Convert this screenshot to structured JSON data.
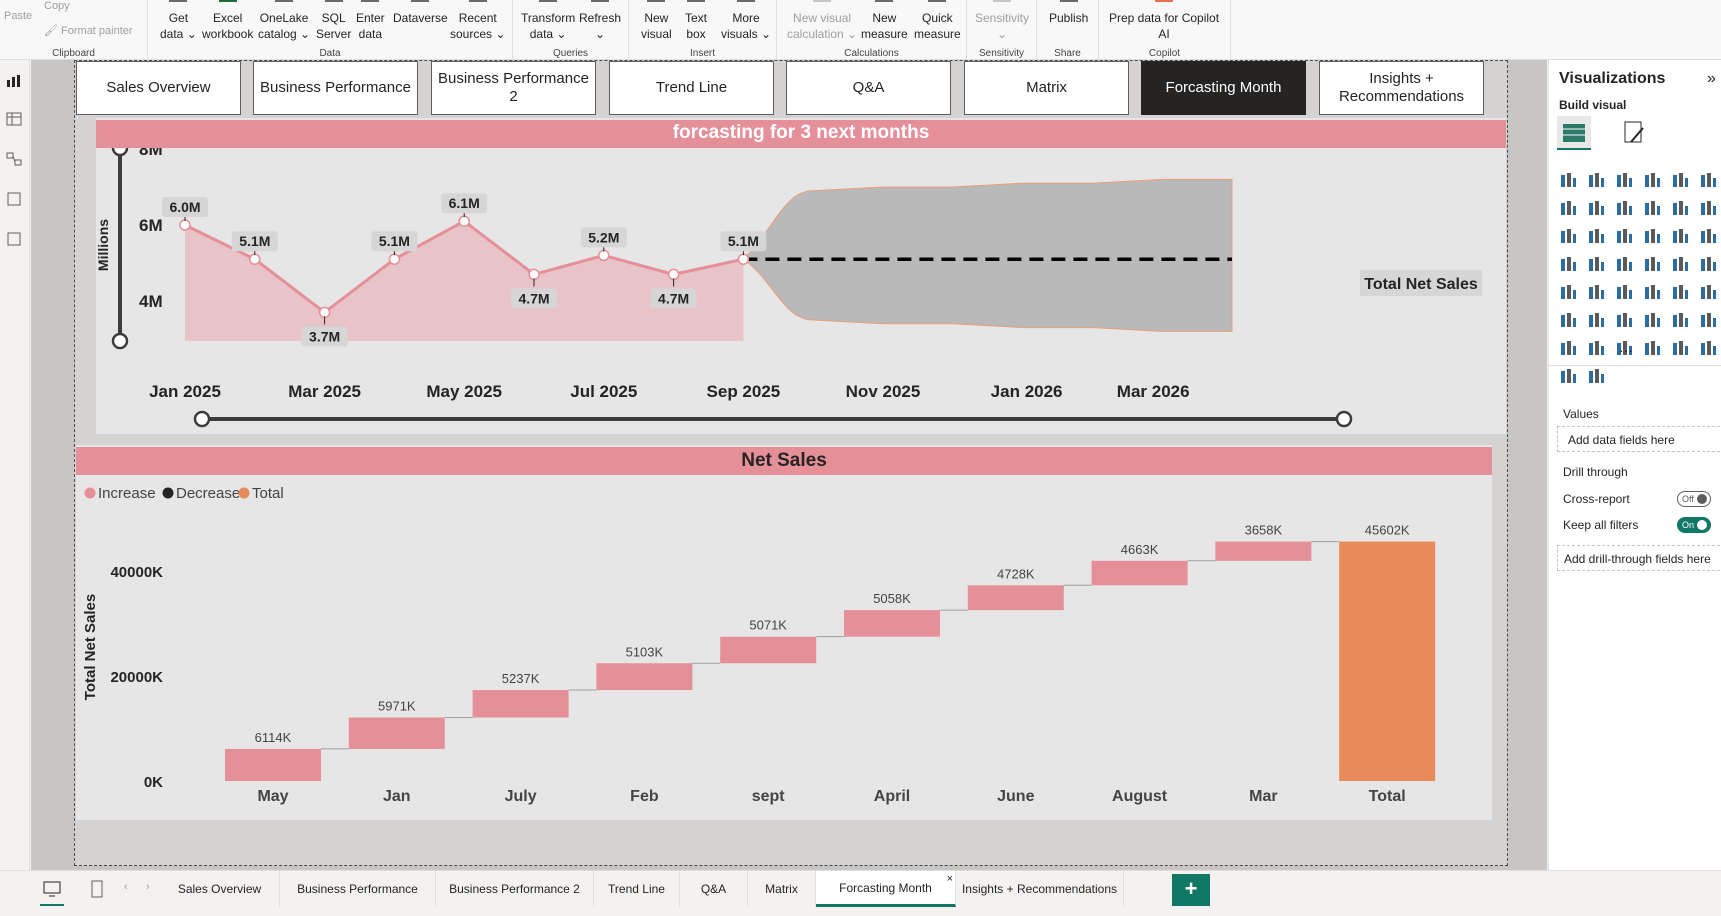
{
  "ribbon": {
    "clipboard": {
      "paste": "Paste",
      "copy": "Copy",
      "format_painter": "Format painter",
      "label": "Clipboard"
    },
    "data": {
      "label": "Data",
      "buttons": [
        {
          "l1": "Get",
          "l2": "data ⌄"
        },
        {
          "l1": "Excel",
          "l2": "workbook"
        },
        {
          "l1": "OneLake",
          "l2": "catalog ⌄"
        },
        {
          "l1": "SQL",
          "l2": "Server"
        },
        {
          "l1": "Enter",
          "l2": "data"
        },
        {
          "l1": "Dataverse",
          "l2": ""
        },
        {
          "l1": "Recent",
          "l2": "sources ⌄"
        }
      ]
    },
    "queries": {
      "label": "Queries",
      "buttons": [
        {
          "l1": "Transform",
          "l2": "data ⌄"
        },
        {
          "l1": "Refresh",
          "l2": "⌄"
        }
      ]
    },
    "insert": {
      "label": "Insert",
      "buttons": [
        {
          "l1": "New",
          "l2": "visual"
        },
        {
          "l1": "Text",
          "l2": "box"
        },
        {
          "l1": "More",
          "l2": "visuals ⌄"
        }
      ]
    },
    "calculations": {
      "label": "Calculations",
      "buttons": [
        {
          "l1": "New visual",
          "l2": "calculation ⌄"
        },
        {
          "l1": "New",
          "l2": "measure"
        },
        {
          "l1": "Quick",
          "l2": "measure"
        }
      ]
    },
    "sensitivity": {
      "label": "Sensitivity",
      "button": "Sensitivity",
      "button2": "⌄"
    },
    "share": {
      "label": "Share",
      "button": "Publish"
    },
    "copilot": {
      "label": "Copilot",
      "l1": "Prep data for Copilot",
      "l2": "AI"
    }
  },
  "nav_buttons": [
    "Sales Overview",
    "Business Performance",
    "Business Performance 2",
    "Trend Line",
    "Q&A",
    "Matrix",
    "Forcasting Month",
    "Insights +\nRecommendations"
  ],
  "forecast": {
    "title": "forcasting for 3 next months",
    "ylabel": "Millions",
    "yticks": [
      "8M",
      "6M",
      "4M"
    ],
    "xticks": [
      "Jan 2025",
      "Mar 2025",
      "May 2025",
      "Jul 2025",
      "Sep 2025",
      "Nov 2025",
      "Jan 2026",
      "Mar 2026"
    ],
    "series_label": "Total Net Sales",
    "colors": {
      "line": "#e58f99",
      "area": "#e8c3c7",
      "band": "#b9b9b9",
      "forecast_line": "#000000"
    }
  },
  "chart_data": [
    {
      "type": "line",
      "title": "forcasting for 3 next months",
      "xlabel": "",
      "ylabel": "Millions",
      "ylim": [
        3.5,
        8
      ],
      "x": [
        "Jan 2025",
        "Feb 2025",
        "Mar 2025",
        "Apr 2025",
        "May 2025",
        "Jun 2025",
        "Jul 2025",
        "Aug 2025",
        "Sep 2025"
      ],
      "series": [
        {
          "name": "Total Net Sales",
          "values": [
            6.0,
            5.1,
            3.7,
            5.1,
            6.1,
            4.7,
            5.2,
            4.7,
            5.1
          ],
          "labels": [
            "6.0M",
            "5.1M",
            "3.7M",
            "5.1M",
            "6.1M",
            "4.7M",
            "5.2M",
            "4.7M",
            "5.1M"
          ]
        }
      ],
      "forecast": {
        "x": [
          "Oct 2025",
          "Nov 2025",
          "Dec 2025",
          "Jan 2026",
          "Feb 2026",
          "Mar 2026",
          "Apr 2026"
        ],
        "value": 5.1,
        "upper": [
          6.9,
          7.0,
          7.0,
          7.1,
          7.1,
          7.2,
          7.2
        ],
        "lower": [
          3.5,
          3.4,
          3.4,
          3.3,
          3.3,
          3.2,
          3.2
        ]
      }
    },
    {
      "type": "bar",
      "subtype": "waterfall",
      "title": "Net Sales",
      "xlabel": "",
      "ylabel": "Total Net Sales",
      "ylim": [
        0,
        48000
      ],
      "yticks": [
        "40000K",
        "20000K",
        "0K"
      ],
      "categories": [
        "May",
        "Jan",
        "July",
        "Feb",
        "sept",
        "April",
        "June",
        "August",
        "Mar",
        "Total"
      ],
      "values": [
        6114,
        5971,
        5237,
        5103,
        5071,
        5058,
        4728,
        4663,
        3658,
        45602
      ],
      "labels": [
        "6114K",
        "5971K",
        "5237K",
        "5103K",
        "5071K",
        "5058K",
        "4728K",
        "4663K",
        "3658K",
        "45602K"
      ],
      "legend": [
        "Increase",
        "Decrease",
        "Total"
      ],
      "legend_colors": [
        "#e58f99",
        "#252423",
        "#e88a5a"
      ],
      "legend_position": "top-left"
    }
  ],
  "waterfall": {
    "title": "Net Sales",
    "ylabel": "Total Net Sales",
    "legend": [
      {
        "name": "Increase",
        "color": "#e58f99"
      },
      {
        "name": "Decrease",
        "color": "#252423"
      },
      {
        "name": "Total",
        "color": "#e88a5a"
      }
    ]
  },
  "right_pane": {
    "title": "Visualizations",
    "collapse": "»",
    "build_visual": "Build visual",
    "values_label": "Values",
    "values_field": "Add data fields here",
    "drill_through": "Drill through",
    "cross_report": "Cross-report",
    "cross_report_state": "Off",
    "keep_filters": "Keep all filters",
    "keep_filters_state": "On",
    "drill_field": "Add drill-through fields here",
    "more": "···"
  },
  "page_tabs": [
    "Sales Overview",
    "Business Performance",
    "Business Performance 2",
    "Trend Line",
    "Q&A",
    "Matrix",
    "Forcasting Month",
    "Insights + Recommendations"
  ],
  "active_tab": "Forcasting Month",
  "tab_close": "×",
  "add_page": "+"
}
